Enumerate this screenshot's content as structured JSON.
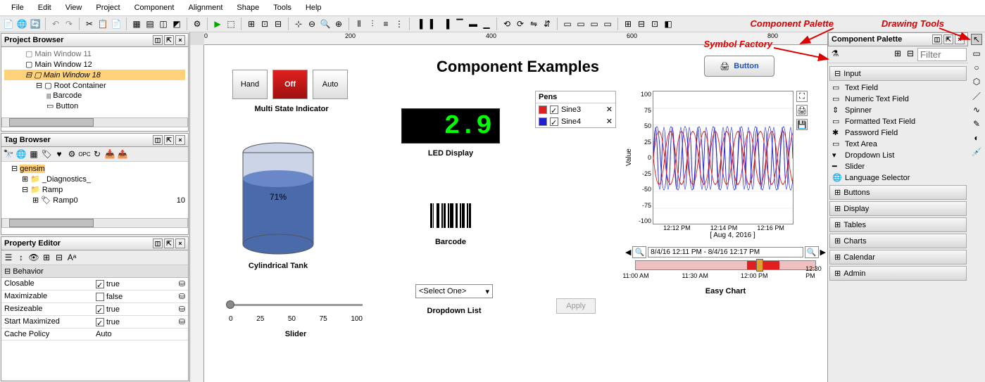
{
  "menubar": [
    "File",
    "Edit",
    "View",
    "Project",
    "Component",
    "Alignment",
    "Shape",
    "Tools",
    "Help"
  ],
  "panels": {
    "project_browser": {
      "title": "Project Browser",
      "items": [
        {
          "label": "Main Window 11",
          "indent": 2
        },
        {
          "label": "Main Window 12",
          "indent": 2
        },
        {
          "label": "Main Window 18",
          "indent": 2,
          "selected": true,
          "italic": true
        },
        {
          "label": "Root Container",
          "indent": 3
        },
        {
          "label": "Barcode",
          "indent": 4
        },
        {
          "label": "Button",
          "indent": 4
        }
      ]
    },
    "tag_browser": {
      "title": "Tag Browser",
      "items": [
        {
          "label": "gensim",
          "indent": 1,
          "selected": true
        },
        {
          "label": "_Diagnostics_",
          "indent": 2
        },
        {
          "label": "Ramp",
          "indent": 2
        },
        {
          "label": "Ramp0",
          "indent": 3,
          "value": "10"
        }
      ]
    },
    "property_editor": {
      "title": "Property Editor",
      "section": "Behavior",
      "rows": [
        {
          "name": "Closable",
          "value": "true",
          "checked": true
        },
        {
          "name": "Maximizable",
          "value": "false",
          "checked": false
        },
        {
          "name": "Resizeable",
          "value": "true",
          "checked": true
        },
        {
          "name": "Start Maximized",
          "value": "true",
          "checked": true
        },
        {
          "name": "Cache Policy",
          "value": "Auto",
          "type": "select"
        }
      ]
    },
    "component_palette": {
      "title": "Component Palette",
      "filter_placeholder": "Filter",
      "categories": [
        {
          "name": "Input",
          "expanded": true,
          "items": [
            "Text Field",
            "Numeric Text Field",
            "Spinner",
            "Formatted Text Field",
            "Password Field",
            "Text Area",
            "Dropdown List",
            "Slider",
            "Language Selector"
          ]
        },
        {
          "name": "Buttons",
          "expanded": false
        },
        {
          "name": "Display",
          "expanded": false
        },
        {
          "name": "Tables",
          "expanded": false
        },
        {
          "name": "Charts",
          "expanded": false
        },
        {
          "name": "Calendar",
          "expanded": false
        },
        {
          "name": "Admin",
          "expanded": false
        }
      ]
    }
  },
  "canvas": {
    "title": "Component Examples",
    "ruler_marks": [
      "0",
      "200",
      "400",
      "600",
      "800"
    ],
    "multi_state": {
      "label": "Multi State Indicator",
      "buttons": [
        "Hand",
        "Off",
        "Auto"
      ],
      "active": 1
    },
    "tank": {
      "label": "Cylindrical Tank",
      "percent": "71%"
    },
    "led": {
      "label": "LED Display",
      "value": "2.9"
    },
    "barcode": {
      "label": "Barcode"
    },
    "dropdown": {
      "label": "Dropdown List",
      "placeholder": "<Select One>"
    },
    "apply_btn": "Apply",
    "slider": {
      "label": "Slider",
      "ticks": [
        "0",
        "25",
        "50",
        "75",
        "100"
      ]
    },
    "pens": {
      "title": "Pens",
      "items": [
        {
          "color": "#e02020",
          "name": "Sine3"
        },
        {
          "color": "#2020d0",
          "name": "Sine4"
        }
      ]
    },
    "button": {
      "label": "Button"
    },
    "easy_chart": {
      "label": "Easy Chart",
      "ylabel": "Value",
      "y_ticks": [
        "100",
        "75",
        "50",
        "25",
        "0",
        "-25",
        "-50",
        "-75",
        "-100"
      ],
      "x_ticks": [
        "12:12 PM",
        "12:14 PM",
        "12:16 PM"
      ],
      "date": "[ Aug 4, 2016 ]",
      "range": "8/4/16 12:11 PM - 8/4/16 12:17 PM",
      "outer_ticks": [
        "11:00 AM",
        "11:30 AM",
        "12:00 PM",
        "12:30 PM"
      ]
    }
  },
  "annotations": {
    "component_palette": "Component Palette",
    "drawing_tools": "Drawing Tools",
    "symbol_factory": "Symbol Factory"
  }
}
